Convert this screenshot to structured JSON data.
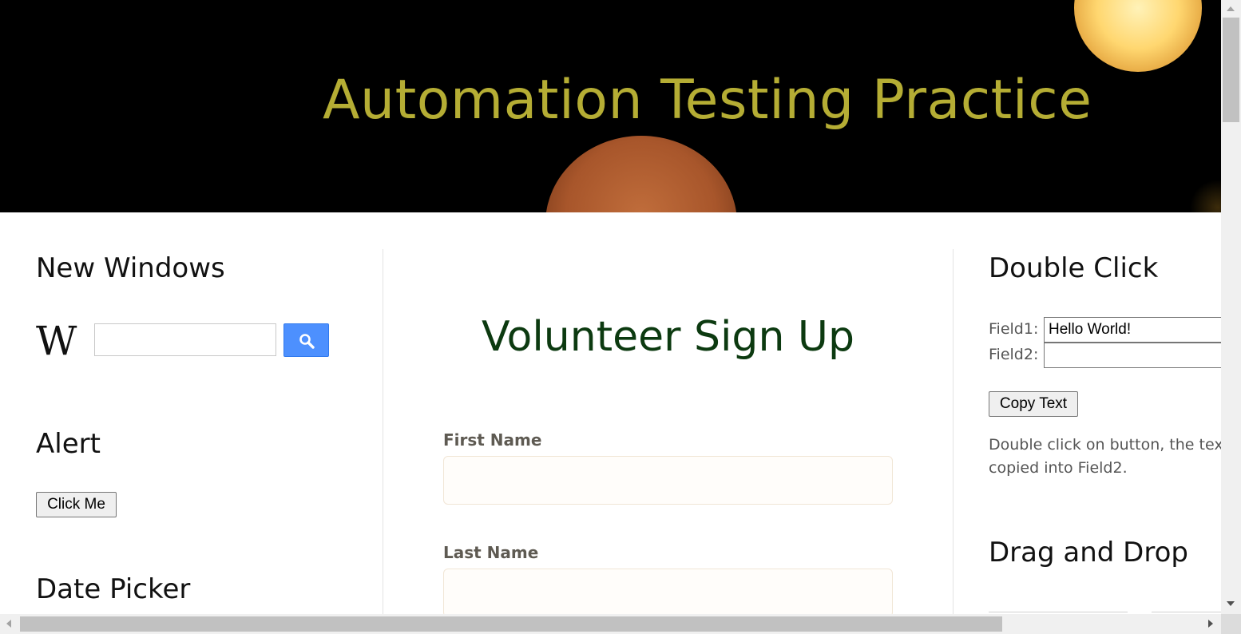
{
  "header": {
    "title": "Automation Testing Practice"
  },
  "left_column": {
    "new_windows": {
      "heading": "New Windows",
      "wiki_logo_text": "W",
      "search_value": "",
      "search_icon": "search-icon"
    },
    "alert": {
      "heading": "Alert",
      "button_label": "Click Me"
    },
    "date_picker": {
      "heading": "Date Picker"
    }
  },
  "center_column": {
    "form_title": "Volunteer Sign Up",
    "fields": [
      {
        "label": "First Name",
        "value": ""
      },
      {
        "label": "Last Name",
        "value": ""
      }
    ]
  },
  "right_column": {
    "double_click": {
      "heading": "Double Click",
      "field1_label": "Field1:",
      "field1_value": "Hello World!",
      "field2_label": "Field2:",
      "field2_value": "",
      "button_label": "Copy Text",
      "description_line1": "Double click on button, the tex",
      "description_line2": "copied into Field2."
    },
    "drag_and_drop": {
      "heading": "Drag and Drop"
    }
  },
  "colors": {
    "title": "#b5ad34",
    "form_title": "#0c3a10",
    "search_button": "#4d90fe"
  }
}
